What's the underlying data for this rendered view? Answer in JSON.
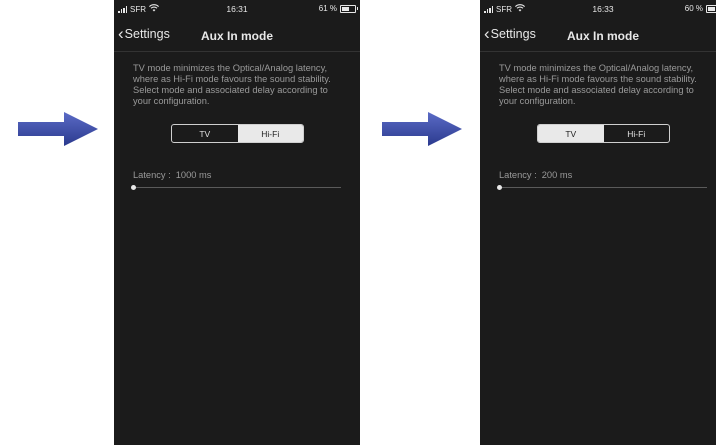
{
  "screens": [
    {
      "carrier": "SFR",
      "time": "16:31",
      "battery": "61 %",
      "battery_level": 0.61,
      "back_label": "Settings",
      "title": "Aux In mode",
      "description": "TV mode minimizes the Optical/Analog latency, where as Hi-Fi mode favours the sound stability. Select mode and associated delay according to your configuration.",
      "mode_options": [
        "TV",
        "Hi-Fi"
      ],
      "selected_mode": "Hi-Fi",
      "latency_label": "Latency :",
      "latency_value": "1000 ms"
    },
    {
      "carrier": "SFR",
      "time": "16:33",
      "battery": "60 %",
      "battery_level": 0.6,
      "back_label": "Settings",
      "title": "Aux In mode",
      "description": "TV mode minimizes the Optical/Analog latency, where as Hi-Fi mode favours the sound stability. Select mode and associated delay according to your configuration.",
      "mode_options": [
        "TV",
        "Hi-Fi"
      ],
      "selected_mode": "TV",
      "latency_label": "Latency :",
      "latency_value": "200 ms"
    }
  ],
  "colors": {
    "screen_bg": "#1b1b1b",
    "arrow": "#3b4aa6",
    "segment_selected": "#e9e9e9"
  }
}
